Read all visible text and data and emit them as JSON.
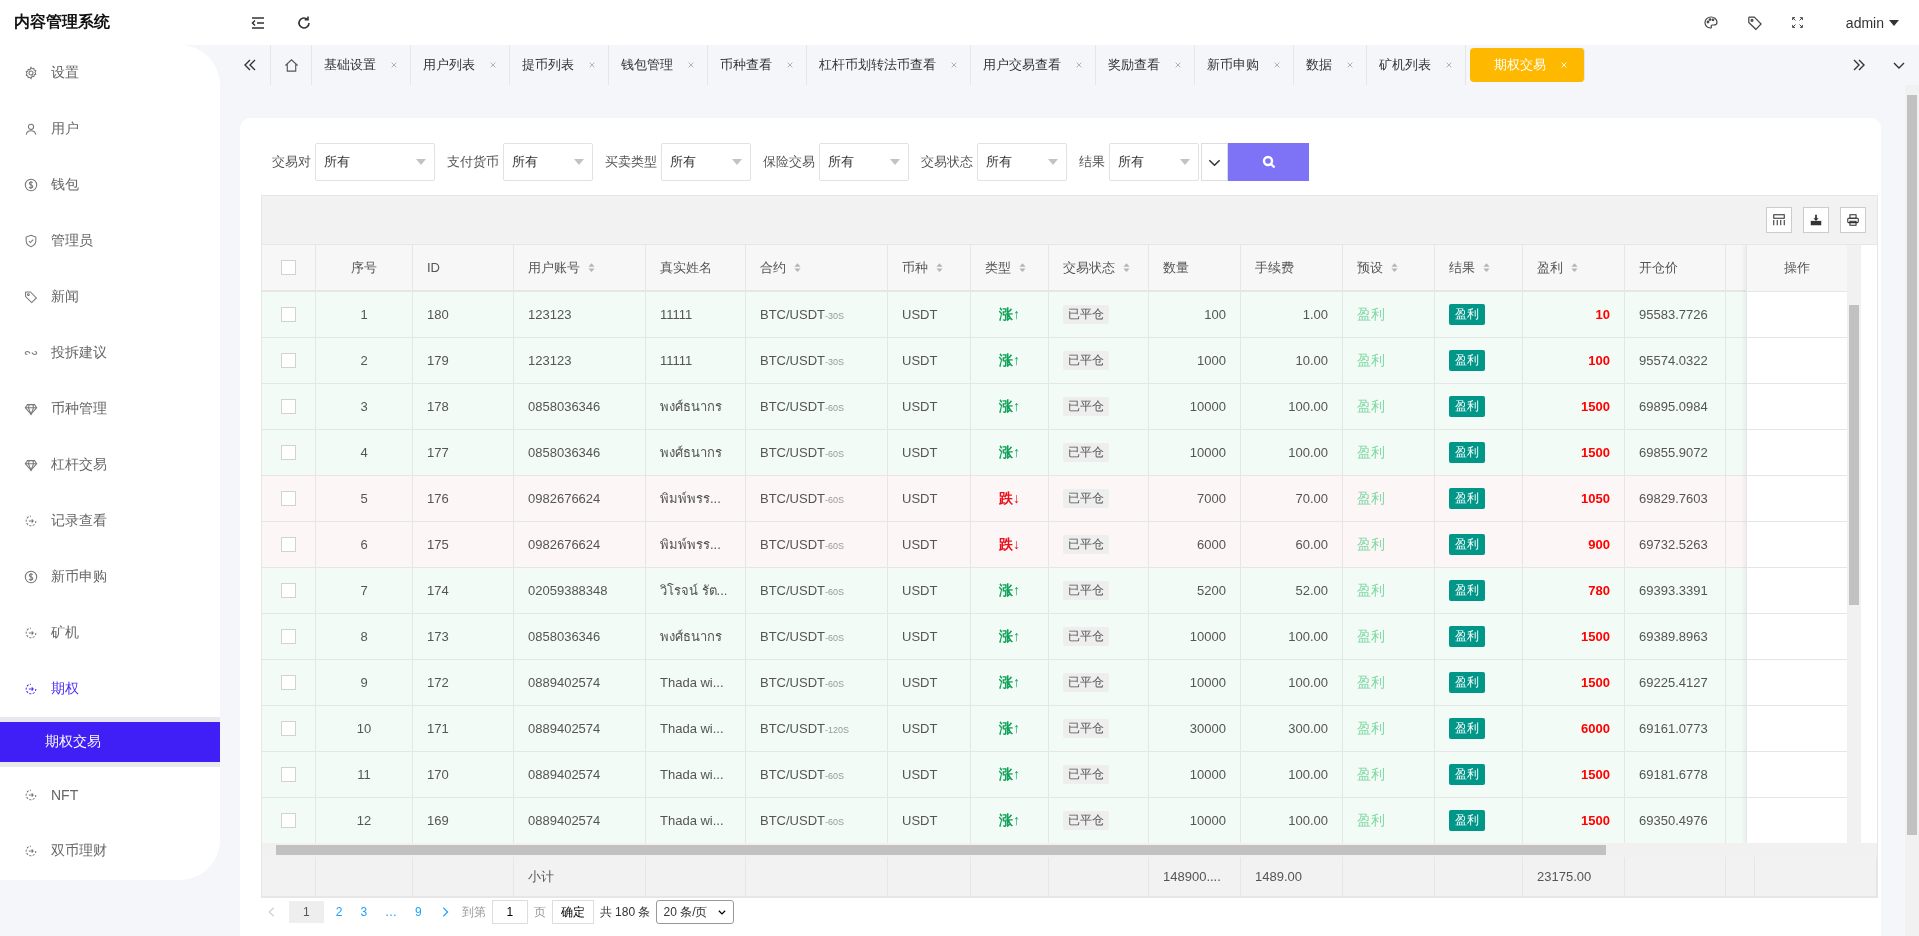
{
  "header": {
    "title": "内容管理系统",
    "user": "admin"
  },
  "sidebar": {
    "items": [
      {
        "label": "设置",
        "kind": "gear",
        "selected": false,
        "expanded": false
      },
      {
        "label": "用户",
        "kind": "user",
        "selected": false,
        "expanded": false
      },
      {
        "label": "钱包",
        "kind": "coin",
        "selected": false,
        "expanded": false
      },
      {
        "label": "管理员",
        "kind": "shield",
        "selected": false,
        "expanded": false
      },
      {
        "label": "新闻",
        "kind": "tag",
        "selected": false,
        "expanded": false
      },
      {
        "label": "投拆建议",
        "kind": "link",
        "selected": false,
        "expanded": false
      },
      {
        "label": "币种管理",
        "kind": "gem",
        "selected": false,
        "expanded": false
      },
      {
        "label": "杠杆交易",
        "kind": "gem",
        "selected": false,
        "expanded": false
      },
      {
        "label": "记录查看",
        "kind": "cycle",
        "selected": false,
        "expanded": false
      },
      {
        "label": "新币申购",
        "kind": "coin",
        "selected": false,
        "expanded": false
      },
      {
        "label": "矿机",
        "kind": "cycle",
        "selected": false,
        "expanded": false
      },
      {
        "label": "期权",
        "kind": "cycle",
        "selected": false,
        "expanded": true,
        "children": [
          {
            "label": "期权交易",
            "selected": true
          }
        ]
      },
      {
        "label": "NFT",
        "kind": "cycle",
        "selected": false,
        "expanded": false
      },
      {
        "label": "双币理财",
        "kind": "cycle",
        "selected": false,
        "expanded": false
      }
    ]
  },
  "tabs": [
    {
      "label": "基础设置",
      "selected": false
    },
    {
      "label": "用户列表",
      "selected": false
    },
    {
      "label": "提币列表",
      "selected": false
    },
    {
      "label": "钱包管理",
      "selected": false
    },
    {
      "label": "币种查看",
      "selected": false
    },
    {
      "label": "杠杆币划转法币查看",
      "selected": false
    },
    {
      "label": "用户交易查看",
      "selected": false
    },
    {
      "label": "奖励查看",
      "selected": false
    },
    {
      "label": "新币申购",
      "selected": false
    },
    {
      "label": "数据",
      "selected": false
    },
    {
      "label": "矿机列表",
      "selected": false
    },
    {
      "label": "期权交易",
      "selected": true
    }
  ],
  "filters": [
    {
      "label": "交易对",
      "value": "所有"
    },
    {
      "label": "支付货币",
      "value": "所有"
    },
    {
      "label": "买卖类型",
      "value": "所有"
    },
    {
      "label": "保险交易",
      "value": "所有"
    },
    {
      "label": "交易状态",
      "value": "所有"
    },
    {
      "label": "结果",
      "value": "所有"
    }
  ],
  "table": {
    "columns": [
      {
        "label": "序号",
        "sortable": false
      },
      {
        "label": "ID",
        "sortable": false
      },
      {
        "label": "用户账号",
        "sortable": true
      },
      {
        "label": "真实姓名",
        "sortable": false
      },
      {
        "label": "合约",
        "sortable": true
      },
      {
        "label": "币种",
        "sortable": true
      },
      {
        "label": "类型",
        "sortable": true
      },
      {
        "label": "交易状态",
        "sortable": true
      },
      {
        "label": "数量",
        "sortable": false
      },
      {
        "label": "手续费",
        "sortable": false
      },
      {
        "label": "预设",
        "sortable": true
      },
      {
        "label": "结果",
        "sortable": true
      },
      {
        "label": "盈利",
        "sortable": true
      },
      {
        "label": "开仓价",
        "sortable": false
      }
    ],
    "actions_header": "操作",
    "header_checked": false,
    "rows": [
      {
        "checked": false,
        "no": "1",
        "id": "180",
        "account": "123123",
        "name": "11111",
        "contract": "BTC/USDT",
        "period": "-30S",
        "currency": "USDT",
        "type": "涨↑",
        "kind": "up",
        "status": "已平仓",
        "quantity": "100",
        "fee": "1.00",
        "preset": "盈利",
        "result": "盈利",
        "profit": "10",
        "open_price": "95583.7726"
      },
      {
        "checked": false,
        "no": "2",
        "id": "179",
        "account": "123123",
        "name": "11111",
        "contract": "BTC/USDT",
        "period": "-30S",
        "currency": "USDT",
        "type": "涨↑",
        "kind": "up",
        "status": "已平仓",
        "quantity": "1000",
        "fee": "10.00",
        "preset": "盈利",
        "result": "盈利",
        "profit": "100",
        "open_price": "95574.0322"
      },
      {
        "checked": false,
        "no": "3",
        "id": "178",
        "account": "0858036346",
        "name": "พงศ์ธนากร",
        "contract": "BTC/USDT",
        "period": "-60S",
        "currency": "USDT",
        "type": "涨↑",
        "kind": "up",
        "status": "已平仓",
        "quantity": "10000",
        "fee": "100.00",
        "preset": "盈利",
        "result": "盈利",
        "profit": "1500",
        "open_price": "69895.0984"
      },
      {
        "checked": false,
        "no": "4",
        "id": "177",
        "account": "0858036346",
        "name": "พงศ์ธนากร",
        "contract": "BTC/USDT",
        "period": "-60S",
        "currency": "USDT",
        "type": "涨↑",
        "kind": "up",
        "status": "已平仓",
        "quantity": "10000",
        "fee": "100.00",
        "preset": "盈利",
        "result": "盈利",
        "profit": "1500",
        "open_price": "69855.9072"
      },
      {
        "checked": false,
        "no": "5",
        "id": "176",
        "account": "0982676624",
        "name": "พิมพ์พรร...",
        "contract": "BTC/USDT",
        "period": "-60S",
        "currency": "USDT",
        "type": "跌↓",
        "kind": "down",
        "status": "已平仓",
        "quantity": "7000",
        "fee": "70.00",
        "preset": "盈利",
        "result": "盈利",
        "profit": "1050",
        "open_price": "69829.7603"
      },
      {
        "checked": false,
        "no": "6",
        "id": "175",
        "account": "0982676624",
        "name": "พิมพ์พรร...",
        "contract": "BTC/USDT",
        "period": "-60S",
        "currency": "USDT",
        "type": "跌↓",
        "kind": "down",
        "status": "已平仓",
        "quantity": "6000",
        "fee": "60.00",
        "preset": "盈利",
        "result": "盈利",
        "profit": "900",
        "open_price": "69732.5263"
      },
      {
        "checked": false,
        "no": "7",
        "id": "174",
        "account": "02059388348",
        "name": "วิโรจน์ รัต...",
        "contract": "BTC/USDT",
        "period": "-60S",
        "currency": "USDT",
        "type": "涨↑",
        "kind": "up",
        "status": "已平仓",
        "quantity": "5200",
        "fee": "52.00",
        "preset": "盈利",
        "result": "盈利",
        "profit": "780",
        "open_price": "69393.3391"
      },
      {
        "checked": false,
        "no": "8",
        "id": "173",
        "account": "0858036346",
        "name": "พงศ์ธนากร",
        "contract": "BTC/USDT",
        "period": "-60S",
        "currency": "USDT",
        "type": "涨↑",
        "kind": "up",
        "status": "已平仓",
        "quantity": "10000",
        "fee": "100.00",
        "preset": "盈利",
        "result": "盈利",
        "profit": "1500",
        "open_price": "69389.8963"
      },
      {
        "checked": false,
        "no": "9",
        "id": "172",
        "account": "0889402574",
        "name": "Thada wi...",
        "contract": "BTC/USDT",
        "period": "-60S",
        "currency": "USDT",
        "type": "涨↑",
        "kind": "up",
        "status": "已平仓",
        "quantity": "10000",
        "fee": "100.00",
        "preset": "盈利",
        "result": "盈利",
        "profit": "1500",
        "open_price": "69225.4127"
      },
      {
        "checked": false,
        "no": "10",
        "id": "171",
        "account": "0889402574",
        "name": "Thada wi...",
        "contract": "BTC/USDT",
        "period": "-120S",
        "currency": "USDT",
        "type": "涨↑",
        "kind": "up",
        "status": "已平仓",
        "quantity": "30000",
        "fee": "300.00",
        "preset": "盈利",
        "result": "盈利",
        "profit": "6000",
        "open_price": "69161.0773"
      },
      {
        "checked": false,
        "no": "11",
        "id": "170",
        "account": "0889402574",
        "name": "Thada wi...",
        "contract": "BTC/USDT",
        "period": "-60S",
        "currency": "USDT",
        "type": "涨↑",
        "kind": "up",
        "status": "已平仓",
        "quantity": "10000",
        "fee": "100.00",
        "preset": "盈利",
        "result": "盈利",
        "profit": "1500",
        "open_price": "69181.6778"
      },
      {
        "checked": false,
        "no": "12",
        "id": "169",
        "account": "0889402574",
        "name": "Thada wi...",
        "contract": "BTC/USDT",
        "period": "-60S",
        "currency": "USDT",
        "type": "涨↑",
        "kind": "up",
        "status": "已平仓",
        "quantity": "10000",
        "fee": "100.00",
        "preset": "盈利",
        "result": "盈利",
        "profit": "1500",
        "open_price": "69350.4976"
      }
    ],
    "subtotal": {
      "label": "小计",
      "quantity": "148900....",
      "fee": "1489.00",
      "profit": "23175.00"
    }
  },
  "pagination": {
    "pages": [
      {
        "label": "1",
        "selected": true
      },
      {
        "label": "2",
        "selected": false
      },
      {
        "label": "3",
        "selected": false
      },
      {
        "label": "…",
        "selected": false
      },
      {
        "label": "9",
        "selected": false
      }
    ],
    "goto_label": "到第",
    "goto_value": "1",
    "page_unit": "页",
    "confirm": "确定",
    "total": "共 180 条",
    "page_size": "20 条/页"
  }
}
